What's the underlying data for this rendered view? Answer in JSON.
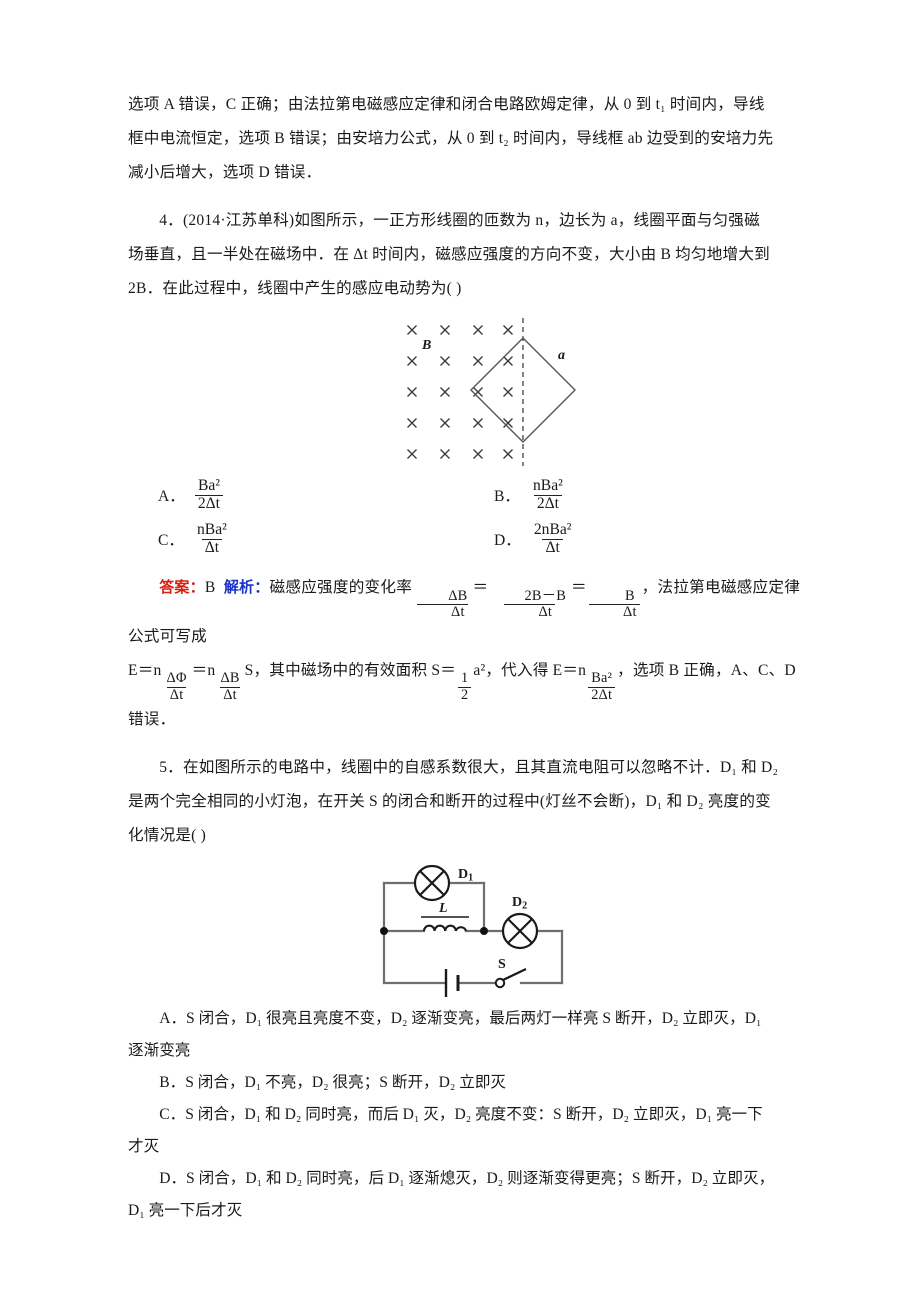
{
  "page": {
    "background": "#ffffff",
    "text_color": "#1a1a1a"
  },
  "colors": {
    "answer_label": "#d81f12",
    "analysis_label": "#1a33c8",
    "ink": "#333333"
  },
  "explanation_prev": {
    "line1": "选项 A 错误，C 正确；由法拉第电磁感应定律和闭合电路欧姆定律，从 0 到 t₁ 时间内，导线",
    "line2": "框中电流恒定，选项 B 错误；由安培力公式，从 0 到 t₂ 时间内，导线框 ab 边受到的安培力先",
    "line3": "减小后增大，选项 D 错误．"
  },
  "q4": {
    "number": "4．",
    "source": "(2014·江苏单科)",
    "stem_1": "如图所示，一正方形线圈的匝数为 n，边长为 a，线圈平面与匀强磁",
    "stem_2": "场垂直，且一半处在磁场中．在 Δt 时间内，磁感应强度的方向不变，大小由 B 均匀地增大到",
    "stem_3": "2B．在此过程中，线圈中产生的感应电动势为(        )",
    "figure": {
      "name": "square-coil-in-field",
      "field_symbol": "×",
      "field_label": "B",
      "side_label": "a",
      "rows": 5,
      "cols": 4,
      "dashed_center_line": true
    },
    "options": [
      {
        "tag": "A．",
        "num": "Ba²",
        "den": "2Δt"
      },
      {
        "tag": "B．",
        "num": "nBa²",
        "den": "2Δt"
      },
      {
        "tag": "C．",
        "num": "nBa²",
        "den": "Δt"
      },
      {
        "tag": "D．",
        "num": "2nBa²",
        "den": "Δt"
      }
    ],
    "answer_label": "答案：",
    "answer_value": "B",
    "analysis_label": "解析：",
    "analysis_1a": "磁感应强度的变化率",
    "analysis_f1_num": "ΔB",
    "analysis_f1_den": "Δt",
    "analysis_eq1": "＝",
    "analysis_f2_num": "2B－B",
    "analysis_f2_den": "Δt",
    "analysis_eq2": "＝",
    "analysis_f3_num": "B",
    "analysis_f3_den": "Δt",
    "analysis_1b": "，法拉第电磁感应定律公式可写成",
    "analysis_2a": "E＝n",
    "analysis_f4_num": "ΔΦ",
    "analysis_f4_den": "Δt",
    "analysis_eq3": "＝n",
    "analysis_f5_num": "ΔB",
    "analysis_f5_den": "Δt",
    "analysis_2b": "S，其中磁场中的有效面积 S＝",
    "analysis_f6_num": "1",
    "analysis_f6_den": "2",
    "analysis_2c": "a²，代入得 E＝n",
    "analysis_f7_num": "Ba²",
    "analysis_f7_den": "2Δt",
    "analysis_2d": "，选项 B 正确，A、C、D",
    "analysis_3": "错误．"
  },
  "q5": {
    "number": "5．",
    "stem_1": "在如图所示的电路中，线圈中的自感系数很大，且其直流电阻可以忽略不计．D₁ 和 D₂",
    "stem_2": "是两个完全相同的小灯泡，在开关 S 的闭合和断开的过程中(灯丝不会断)，D₁ 和 D₂ 亮度的变",
    "stem_3": "化情况是(        )",
    "figure": {
      "name": "self-inductance-circuit",
      "lamp1_label": "D₁",
      "lamp2_label": "D₂",
      "inductor_label": "L",
      "switch_label": "S",
      "battery": "battery-symbol",
      "switch_state": "open"
    },
    "options": [
      {
        "tag": "A．",
        "line1": "S 闭合，D₁ 很亮且亮度不变，D₂ 逐渐变亮，最后两灯一样亮 S 断开，D₂ 立即灭，D₁",
        "line2": "逐渐变亮"
      },
      {
        "tag": "B．",
        "line1": "S 闭合，D₁ 不亮，D₂ 很亮；S 断开，D₂ 立即灭",
        "line2": ""
      },
      {
        "tag": "C．",
        "line1": "S 闭合，D₁ 和 D₂ 同时亮，而后 D₁ 灭，D₂ 亮度不变：S 断开，D₂ 立即灭，D₁ 亮一下",
        "line2": "才灭"
      },
      {
        "tag": "D．",
        "line1": "S 闭合，D₁ 和 D₂ 同时亮，后 D₁ 逐渐熄灭，D₂ 则逐渐变得更亮；S 断开，D₂ 立即灭，",
        "line2": "D₁ 亮一下后才灭"
      }
    ]
  }
}
